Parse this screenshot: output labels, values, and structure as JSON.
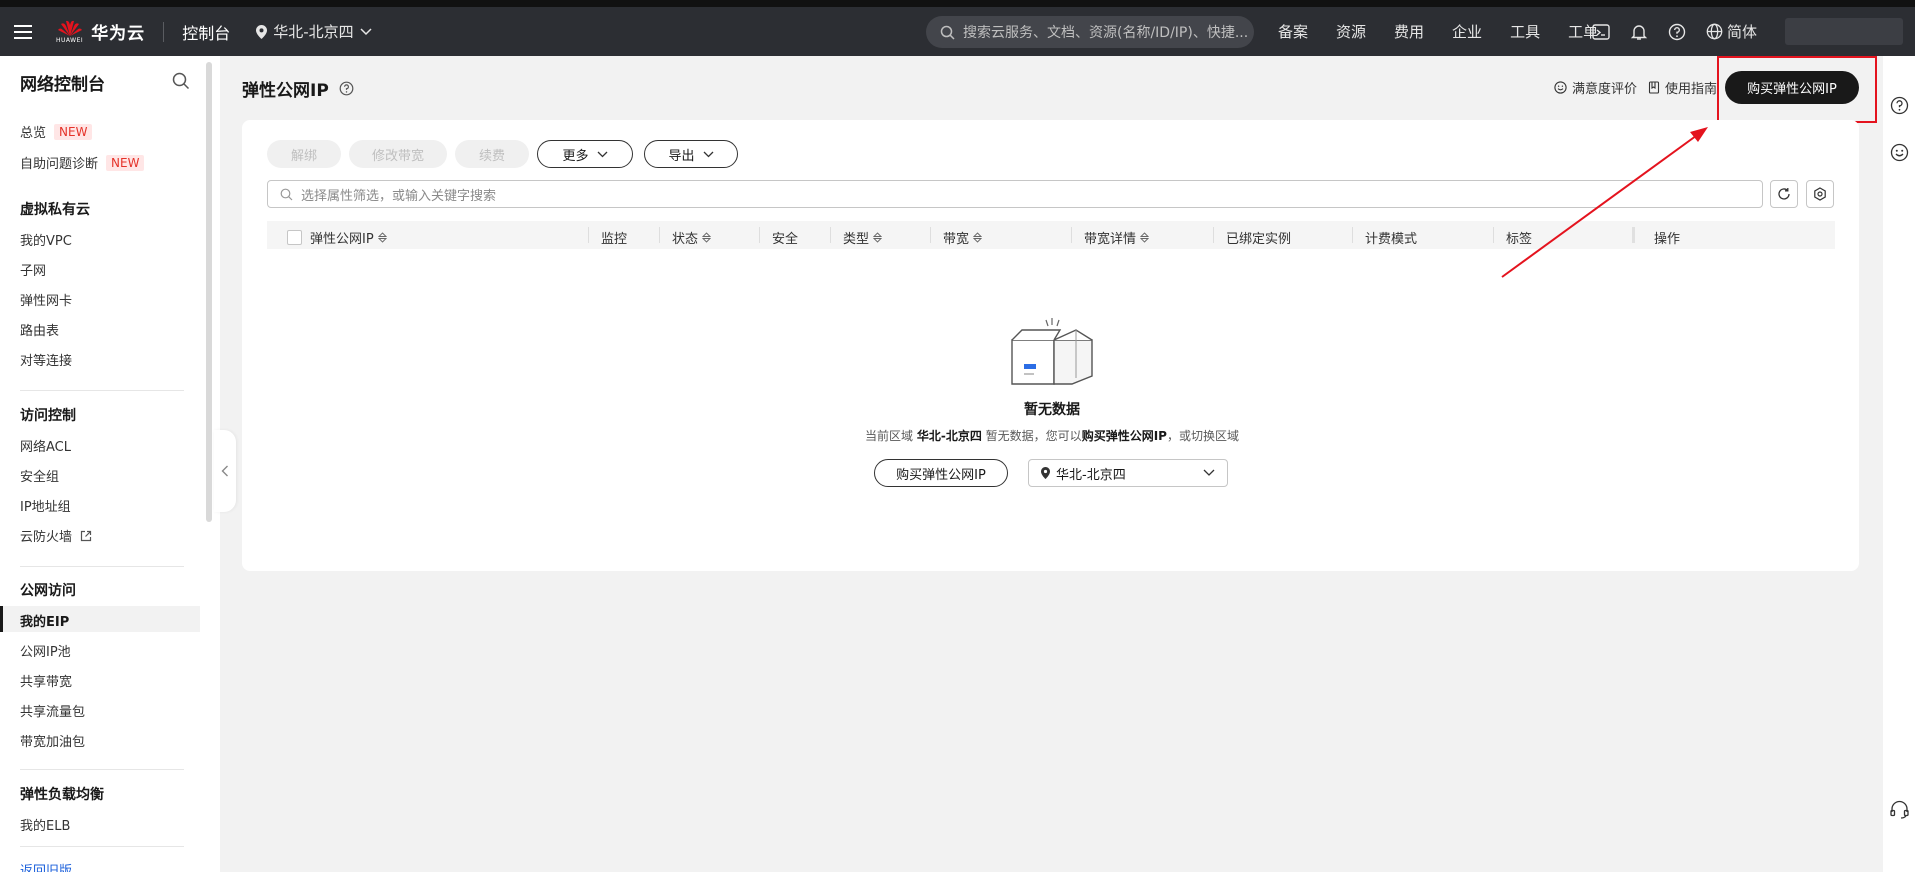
{
  "topbar": {
    "brand": "华为云",
    "logo_caption": "HUAWEI",
    "console": "控制台",
    "region": "华北-北京四",
    "search_placeholder": "搜索云服务、文档、资源(名称/ID/IP)、快捷...",
    "nav": [
      "备案",
      "资源",
      "费用",
      "企业",
      "工具",
      "工单"
    ],
    "language": "简体"
  },
  "sidebar": {
    "title": "网络控制台",
    "new_tag": "NEW",
    "top_items": [
      "总览",
      "自助问题诊断"
    ],
    "groups": [
      {
        "title": "虚拟私有云",
        "items": [
          "我的VPC",
          "子网",
          "弹性网卡",
          "路由表",
          "对等连接"
        ]
      },
      {
        "title": "访问控制",
        "items": [
          "网络ACL",
          "安全组",
          "IP地址组",
          "云防火墙"
        ]
      },
      {
        "title": "公网访问",
        "items": [
          "我的EIP",
          "公网IP池",
          "共享带宽",
          "共享流量包",
          "带宽加油包"
        ]
      },
      {
        "title": "弹性负载均衡",
        "items": [
          "我的ELB"
        ]
      }
    ],
    "back_link": "返回旧版"
  },
  "header": {
    "title": "弹性公网IP",
    "rating": "满意度评价",
    "guide": "使用指南",
    "buy": "购买弹性公网IP"
  },
  "toolbar": {
    "unbind": "解绑",
    "modify_bandwidth": "修改带宽",
    "renew": "续费",
    "more": "更多",
    "export": "导出"
  },
  "filter": {
    "placeholder": "选择属性筛选，或输入关键字搜索"
  },
  "table": {
    "columns": [
      "弹性公网IP",
      "监控",
      "状态",
      "安全",
      "类型",
      "带宽",
      "带宽详情",
      "已绑定实例",
      "计费模式",
      "标签",
      "操作"
    ]
  },
  "empty": {
    "title": "暂无数据",
    "desc_1": "当前区域",
    "desc_region": "华北-北京四",
    "desc_2": "暂无数据，您可以",
    "desc_link": "购买弹性公网IP",
    "desc_3": "，或切换区域",
    "buy_button": "购买弹性公网IP",
    "region_select": "华北-北京四"
  },
  "colors": {
    "accent": "#191919",
    "annotation": "#e4131e",
    "link": "#1a5fdb",
    "new_tag": "#e5332a"
  }
}
